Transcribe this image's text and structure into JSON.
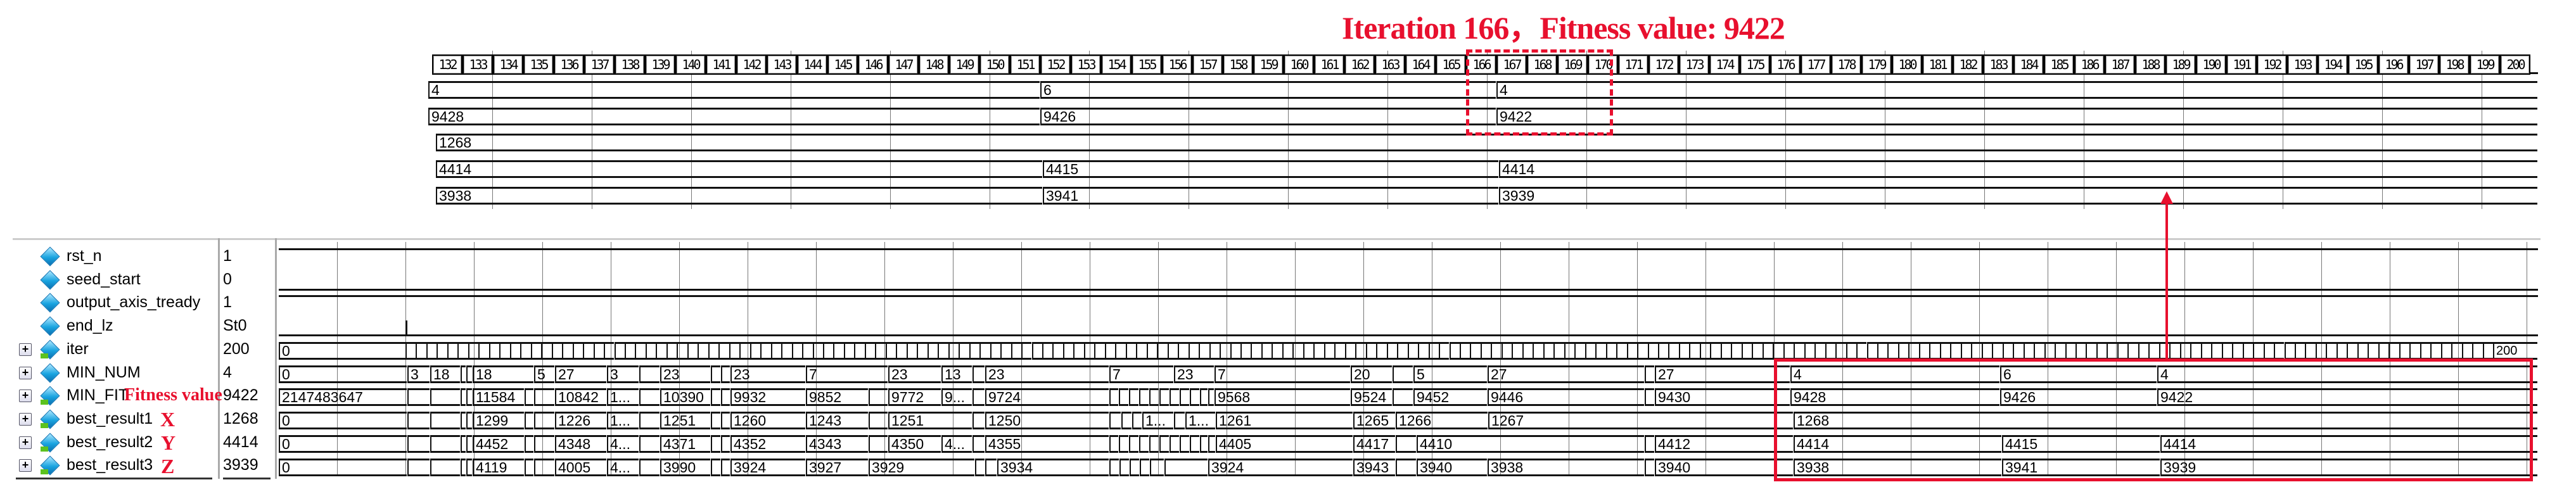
{
  "annotation": {
    "title": "Iteration 166，Fitness value: 9422",
    "fitness_label": "Fitness value",
    "x_label": "X",
    "y_label": "Y",
    "z_label": "Z",
    "accent_color": "#e8102e"
  },
  "zoom_panel": {
    "iter_labels": [
      "132",
      "133",
      "134",
      "135",
      "136",
      "137",
      "138",
      "139",
      "140",
      "141",
      "142",
      "143",
      "144",
      "145",
      "146",
      "147",
      "148",
      "149",
      "150",
      "151",
      "152",
      "153",
      "154",
      "155",
      "156",
      "157",
      "158",
      "159",
      "160",
      "161",
      "162",
      "163",
      "164",
      "165",
      "166",
      "167",
      "168",
      "169",
      "170",
      "171",
      "172",
      "173",
      "174",
      "175",
      "176",
      "177",
      "178",
      "179",
      "180",
      "181",
      "182",
      "183",
      "184",
      "185",
      "186",
      "187",
      "188",
      "189",
      "190",
      "191",
      "192",
      "193",
      "194",
      "195",
      "196",
      "197",
      "198",
      "199",
      "200"
    ],
    "rows": [
      {
        "signal": "MIN_NUM",
        "values": [
          "4",
          "6",
          "4"
        ]
      },
      {
        "signal": "MIN_FIT",
        "values": [
          "9428",
          "9426",
          "9422"
        ]
      },
      {
        "signal": "best_result1",
        "values": [
          "1268"
        ]
      },
      {
        "signal": "best_result2",
        "values": [
          "4414",
          "4415",
          "4414"
        ]
      },
      {
        "signal": "best_result3",
        "values": [
          "3938",
          "3941",
          "3939"
        ]
      }
    ]
  },
  "signals": [
    {
      "name": "rst_n",
      "value": "1",
      "expandable": false,
      "arrow": false
    },
    {
      "name": "seed_start",
      "value": "0",
      "expandable": false,
      "arrow": false
    },
    {
      "name": "output_axis_tready",
      "value": "1",
      "expandable": false,
      "arrow": false
    },
    {
      "name": "end_lz",
      "value": "St0",
      "expandable": false,
      "arrow": false
    },
    {
      "name": "iter",
      "value": "200",
      "expandable": true,
      "arrow": true
    },
    {
      "name": "MIN_NUM",
      "value": "4",
      "expandable": true,
      "arrow": false
    },
    {
      "name": "MIN_FIT",
      "value": "9422",
      "expandable": true,
      "arrow": true
    },
    {
      "name": "best_result1",
      "value": "1268",
      "expandable": true,
      "arrow": true
    },
    {
      "name": "best_result2",
      "value": "4414",
      "expandable": true,
      "arrow": true
    },
    {
      "name": "best_result3",
      "value": "3939",
      "expandable": true,
      "arrow": true
    }
  ],
  "expand_symbol": "+",
  "waves": {
    "iter": {
      "initial": "0",
      "final": "200"
    },
    "min_num": [
      "0",
      "3",
      "18",
      "",
      "",
      "18",
      "5",
      "27",
      "3",
      "",
      "23",
      "",
      "",
      "23",
      "7",
      "23",
      "13",
      "",
      "23",
      "7",
      "23",
      "7",
      "20",
      "",
      "5",
      "27",
      "",
      "27",
      "4",
      "6",
      "4"
    ],
    "min_fit": [
      "2147483647",
      "",
      "",
      "",
      "",
      "11584",
      "",
      "",
      "10842",
      "1...",
      "",
      "10390",
      "",
      "",
      "9932",
      "9852",
      "",
      "9772",
      "9...",
      "",
      "9724",
      "",
      "",
      "",
      "",
      "",
      "",
      "",
      "",
      "",
      "",
      "",
      "9568",
      "9524",
      "",
      "9452",
      "9446",
      "",
      "9430",
      "9428",
      "9426",
      "9422"
    ],
    "best1": [
      "0",
      "",
      "",
      "",
      "",
      "1299",
      "",
      "",
      "1226",
      "1...",
      "",
      "1251",
      "",
      "",
      "1260",
      "1243",
      "",
      "1251",
      "",
      "1250",
      "",
      "",
      "",
      "1...",
      "",
      "1...",
      "1261",
      "1265",
      "1266",
      "1267",
      "1268"
    ],
    "best2": [
      "0",
      "",
      "",
      "",
      "",
      "4452",
      "",
      "",
      "4348",
      "4...",
      "",
      "4371",
      "",
      "",
      "4352",
      "4343",
      "",
      "4350",
      "4...",
      "",
      "4355",
      "",
      "",
      "",
      "",
      "",
      "",
      "",
      "",
      "",
      "",
      "",
      "4405",
      "4417",
      "",
      "4410",
      "",
      "4412",
      "4414",
      "4415",
      "4414"
    ],
    "best3": [
      "0",
      "",
      "",
      "",
      "",
      "4119",
      "",
      "",
      "4005",
      "4...",
      "",
      "3990",
      "",
      "",
      "3924",
      "3927",
      "3929",
      "",
      "",
      "3934",
      "",
      "",
      "",
      "",
      "",
      "",
      "3924",
      "3943",
      "",
      "3940",
      "3938",
      "",
      "3940",
      "3938",
      "3941",
      "3939"
    ]
  }
}
